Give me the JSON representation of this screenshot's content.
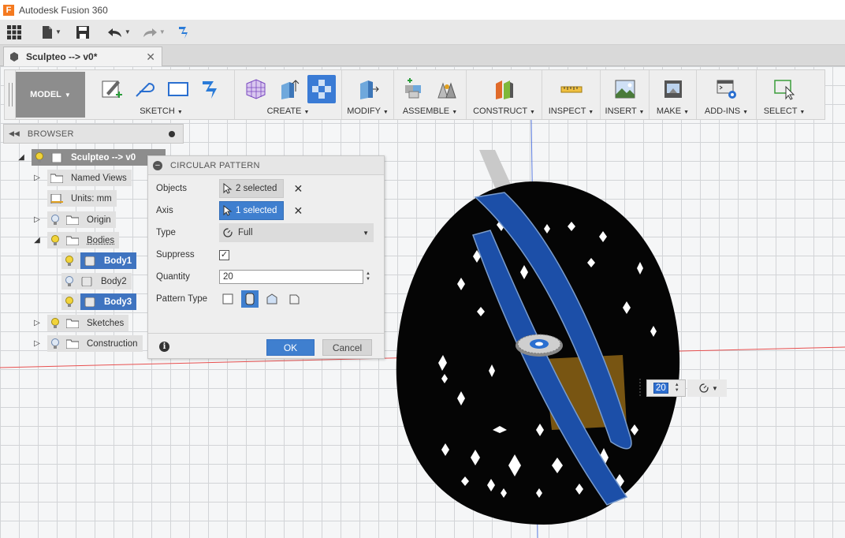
{
  "window": {
    "title": "Autodesk Fusion 360",
    "app_icon": "F"
  },
  "document_tab": {
    "label": "Sculpteo --> v0*"
  },
  "toolbar": {
    "workspace": "MODEL",
    "groups": {
      "sketch": "SKETCH",
      "create": "CREATE",
      "modify": "MODIFY",
      "assemble": "ASSEMBLE",
      "construct": "CONSTRUCT",
      "inspect": "INSPECT",
      "insert": "INSERT",
      "make": "MAKE",
      "addins": "ADD-INS",
      "select": "SELECT"
    }
  },
  "browser": {
    "title": "BROWSER",
    "root": "Sculpteo --> v0",
    "items": {
      "named_views": "Named Views",
      "units": "Units: mm",
      "origin": "Origin",
      "bodies": "Bodies",
      "body1": "Body1",
      "body2": "Body2",
      "body3": "Body3",
      "sketches": "Sketches",
      "construction": "Construction"
    }
  },
  "dialog": {
    "title": "CIRCULAR PATTERN",
    "objects_label": "Objects",
    "objects_value": "2 selected",
    "axis_label": "Axis",
    "axis_value": "1 selected",
    "type_label": "Type",
    "type_value": "Full",
    "suppress_label": "Suppress",
    "suppress_checked": "✓",
    "quantity_label": "Quantity",
    "quantity_value": "20",
    "pattern_type_label": "Pattern Type",
    "ok": "OK",
    "cancel": "Cancel"
  },
  "inline_quantity": "20",
  "colors": {
    "accent": "#3f7fcf",
    "selected_body": "#1c4fa8",
    "model": "#050505",
    "axis_red": "#e64040",
    "axis_blue": "#5a7be0"
  }
}
